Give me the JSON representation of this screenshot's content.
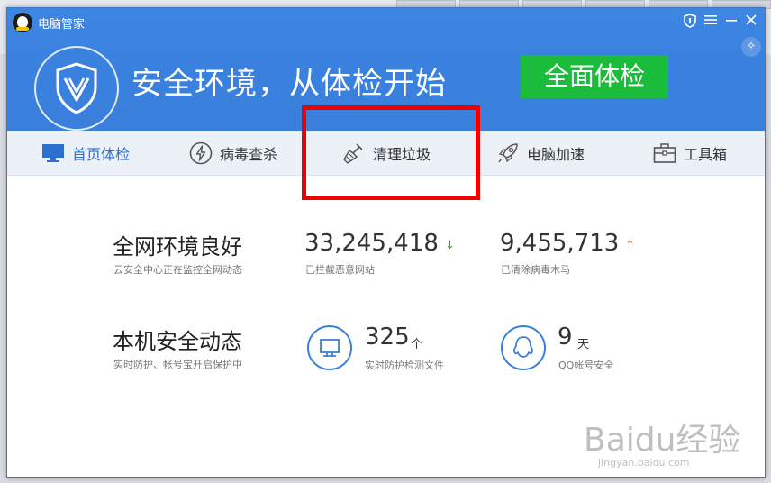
{
  "app": {
    "title": "电脑管家"
  },
  "header": {
    "headline": "安全环境，从体检开始",
    "scan_button": "全面体检"
  },
  "nav": [
    {
      "label": "首页体检",
      "icon": "monitor-icon",
      "active": true
    },
    {
      "label": "病毒查杀",
      "icon": "lightning-icon",
      "active": false
    },
    {
      "label": "清理垃圾",
      "icon": "broom-icon",
      "active": false
    },
    {
      "label": "电脑加速",
      "icon": "rocket-icon",
      "active": false
    },
    {
      "label": "工具箱",
      "icon": "toolbox-icon",
      "active": false
    }
  ],
  "network": {
    "title": "全网环境良好",
    "subtitle": "云安全中心正在监控全网动态",
    "blocked_count": "33,245,418",
    "blocked_label": "已拦截恶意网站",
    "cleared_count": "9,455,713",
    "cleared_label": "已清除病毒木马",
    "blocked_trend": "↓",
    "cleared_trend": "↑"
  },
  "local": {
    "title": "本机安全动态",
    "subtitle": "实时防护、帐号宝开启保护中",
    "files_count": "325",
    "files_unit": "个",
    "files_label": "实时防护检测文件",
    "qq_days": "9",
    "qq_unit": "天",
    "qq_label": "QQ帐号安全"
  },
  "watermark": {
    "main": "Baidu经验",
    "url": "jingyan.baidu.com"
  },
  "colors": {
    "brand_blue": "#3a80de",
    "scan_green": "#1bbc3b",
    "highlight_red": "#ee0000"
  }
}
